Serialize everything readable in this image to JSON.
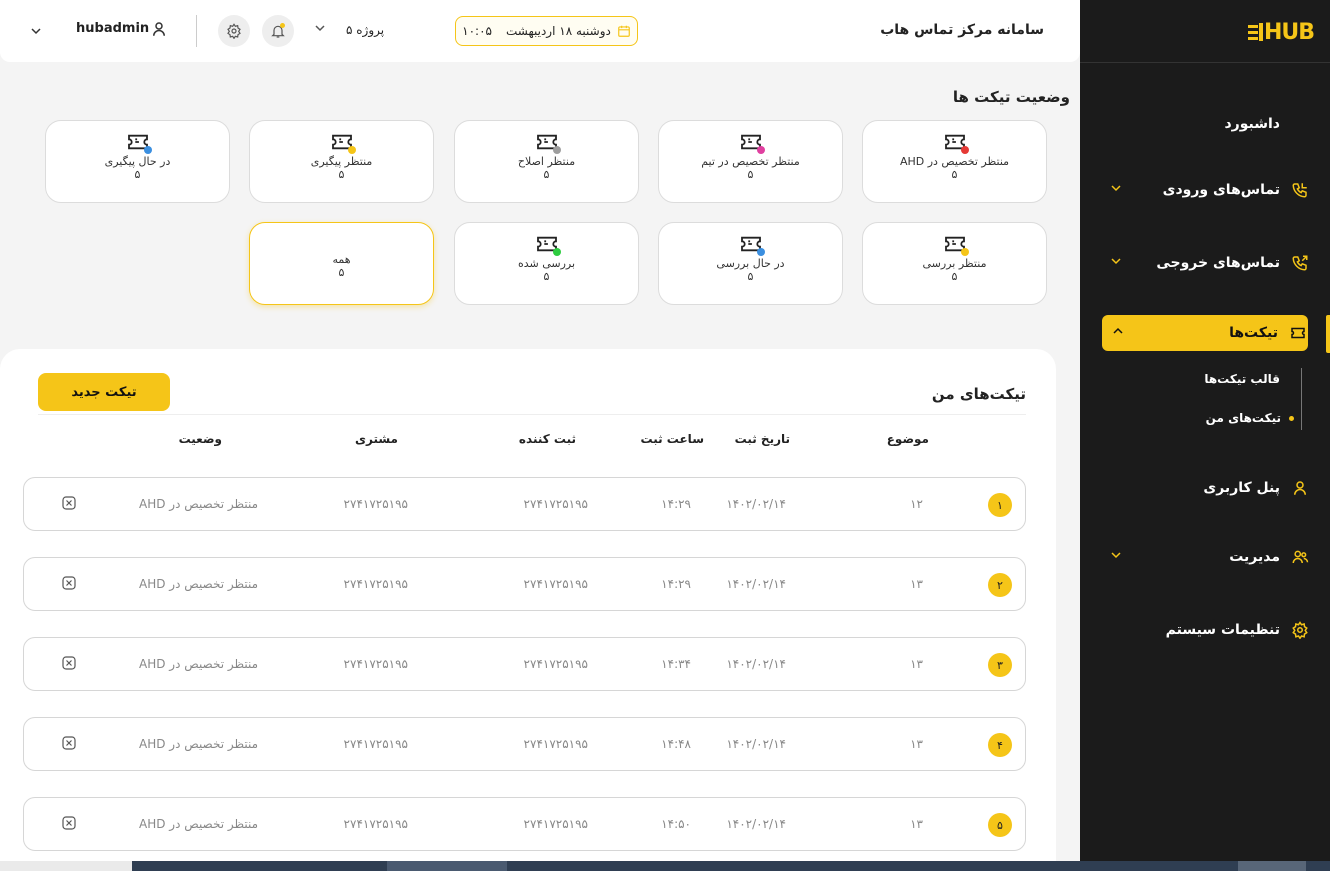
{
  "brand": {
    "logo": "HUB",
    "accent": "#f5c518",
    "sidebar_bg": "#1b1b1b"
  },
  "header": {
    "title": "سامانه مرکز تماس هاب",
    "date": "دوشنبه ۱۸ اردیبهشت",
    "time": "۱۰:۰۵",
    "project": "پروژه ۵",
    "username": "hubadmin"
  },
  "sidebar": {
    "dashboard": "داشبورد",
    "incoming": "تماس‌های ورودی",
    "outgoing": "تماس‌های خروجی",
    "tickets": "تیکت‌ها",
    "ticket_templates": "قالب تیکت‌ها",
    "my_tickets": "تیکت‌های من",
    "user_panel": "پنل کاربری",
    "management": "مدیریت",
    "system_settings": "تنظیمات سیستم"
  },
  "status": {
    "title": "وضعیت تیکت ها",
    "cards": [
      {
        "label": "منتظر تخصیص در AHD",
        "count": "۵",
        "dot": "#e53935"
      },
      {
        "label": "منتظر تخصیص در تیم",
        "count": "۵",
        "dot": "#e040a0"
      },
      {
        "label": "منتظر اصلاح",
        "count": "۵",
        "dot": "#9e9e9e"
      },
      {
        "label": "منتظر پیگیری",
        "count": "۵",
        "dot": "#f5c518"
      },
      {
        "label": "در حال پیگیری",
        "count": "۵",
        "dot": "#3b8fe0"
      },
      {
        "label": "منتظر بررسی",
        "count": "۵",
        "dot": "#f5c518"
      },
      {
        "label": "در حال بررسی",
        "count": "۵",
        "dot": "#3b8fe0"
      },
      {
        "label": "بررسی شده",
        "count": "۵",
        "dot": "#2ecc40"
      },
      {
        "label": "همه",
        "count": "۵",
        "dot": ""
      }
    ]
  },
  "my_tickets": {
    "title": "تیکت‌های من",
    "new_button": "تیکت جدید",
    "headers": {
      "subject": "موضوع",
      "date": "تاریخ ثبت",
      "time": "ساعت ثبت",
      "creator": "ثبت کننده",
      "customer": "مشتری",
      "status": "وضعیت"
    },
    "rows": [
      {
        "num": "۱",
        "subject": "۱۲",
        "date": "۱۴۰۲/۰۲/۱۴",
        "time": "۱۴:۲۹",
        "creator": "۲۷۴۱۷۲۵۱۹۵",
        "customer": "۲۷۴۱۷۲۵۱۹۵",
        "status": "منتظر تخصیص در AHD"
      },
      {
        "num": "۲",
        "subject": "۱۳",
        "date": "۱۴۰۲/۰۲/۱۴",
        "time": "۱۴:۲۹",
        "creator": "۲۷۴۱۷۲۵۱۹۵",
        "customer": "۲۷۴۱۷۲۵۱۹۵",
        "status": "منتظر تخصیص در AHD"
      },
      {
        "num": "۳",
        "subject": "۱۳",
        "date": "۱۴۰۲/۰۲/۱۴",
        "time": "۱۴:۳۴",
        "creator": "۲۷۴۱۷۲۵۱۹۵",
        "customer": "۲۷۴۱۷۲۵۱۹۵",
        "status": "منتظر تخصیص در AHD"
      },
      {
        "num": "۴",
        "subject": "۱۳",
        "date": "۱۴۰۲/۰۲/۱۴",
        "time": "۱۴:۴۸",
        "creator": "۲۷۴۱۷۲۵۱۹۵",
        "customer": "۲۷۴۱۷۲۵۱۹۵",
        "status": "منتظر تخصیص در AHD"
      },
      {
        "num": "۵",
        "subject": "۱۳",
        "date": "۱۴۰۲/۰۲/۱۴",
        "time": "۱۴:۵۰",
        "creator": "۲۷۴۱۷۲۵۱۹۵",
        "customer": "۲۷۴۱۷۲۵۱۹۵",
        "status": "منتظر تخصیص در AHD"
      }
    ]
  }
}
